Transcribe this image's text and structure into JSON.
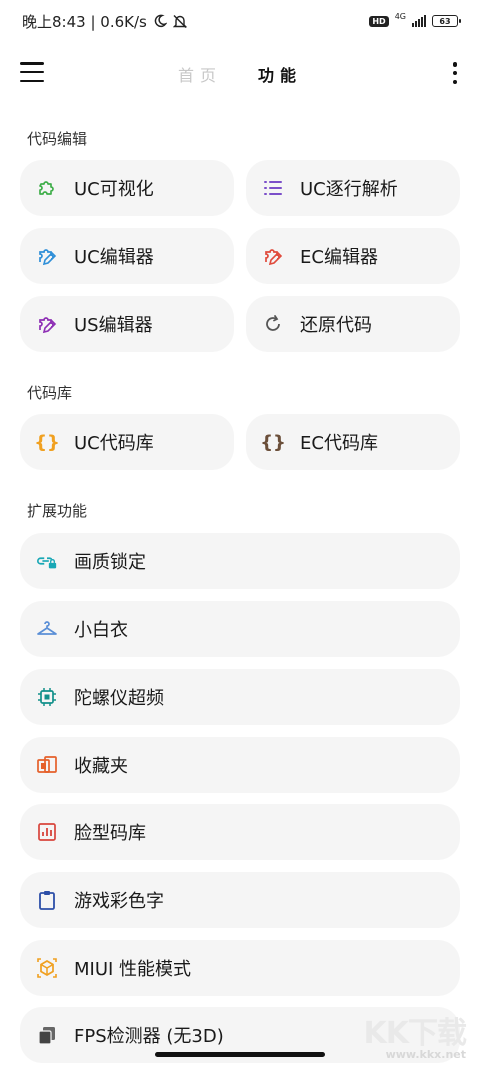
{
  "status_bar": {
    "time_speed": "晚上8:43 | 0.6K/s",
    "hd": "HD",
    "network": "4G",
    "battery": "63"
  },
  "app_bar": {
    "tabs": [
      "首页",
      "功能"
    ],
    "active_tab": "功能"
  },
  "sections": {
    "code_edit": {
      "title": "代码编辑",
      "items": [
        "UC可视化",
        "UC逐行解析",
        "UC编辑器",
        "EC编辑器",
        "US编辑器",
        "还原代码"
      ]
    },
    "code_lib": {
      "title": "代码库",
      "items": [
        "UC代码库",
        "EC代码库"
      ]
    },
    "extended": {
      "title": "扩展功能",
      "items": [
        "画质锁定",
        "小白衣",
        "陀螺仪超频",
        "收藏夹",
        "脸型码库",
        "游戏彩色字",
        "MIUI 性能模式",
        "FPS检测器 (无3D)"
      ]
    }
  },
  "icons": {
    "uc_visual": "puzzle-icon",
    "uc_line": "list-icon",
    "uc_editor": "puzzle-edit-icon",
    "ec_editor": "puzzle-edit-icon",
    "us_editor": "puzzle-edit-icon",
    "restore": "refresh-icon",
    "uc_lib": "braces-icon",
    "ec_lib": "braces-icon",
    "quality_lock": "link-lock-icon",
    "small_white": "hanger-icon",
    "gyro": "chip-icon",
    "favorites": "folder-icon",
    "face_lib": "chart-icon",
    "color_text": "clipboard-icon",
    "miui_mode": "cube-icon",
    "fps": "copy-icon"
  },
  "colors": {
    "green": "#3fae4a",
    "purple": "#7b4fc9",
    "blue": "#2f8fd8",
    "red": "#e04b3c",
    "magenta": "#8e2fb5",
    "gray": "#555555",
    "orange": "#f0a020",
    "brown": "#6b4f3a",
    "teal": "#18a7b5",
    "card_bg": "#f5f5f5"
  },
  "watermark": {
    "logo": "KK下载",
    "url": "www.kkx.net"
  }
}
